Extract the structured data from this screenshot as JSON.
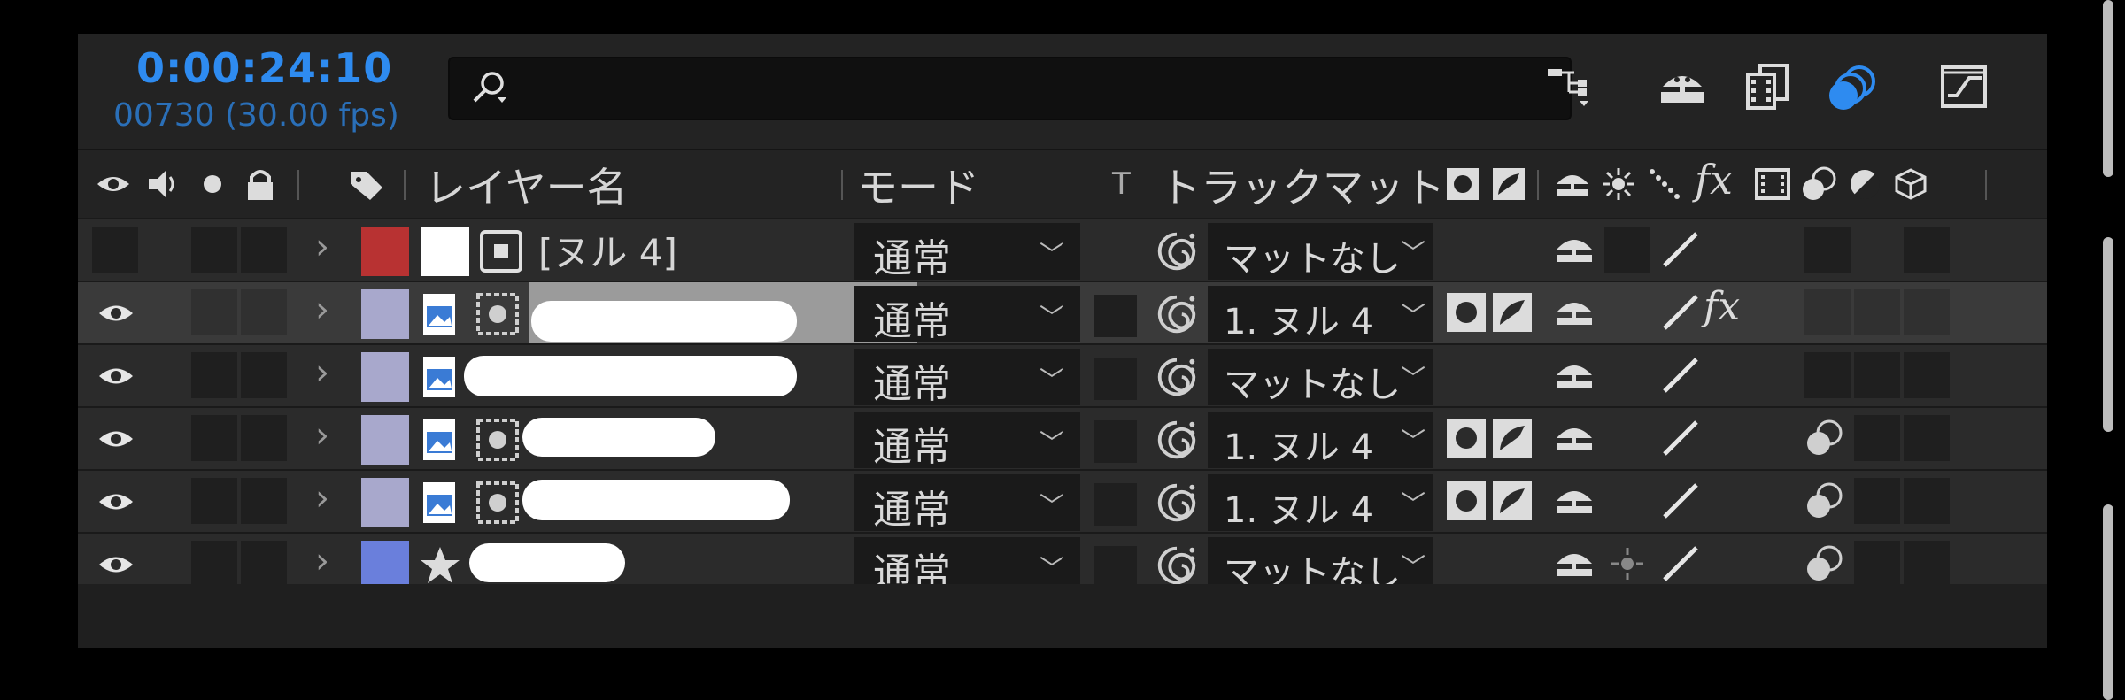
{
  "timeline": {
    "timecode": "0:00:24:10",
    "frames": "00730 (30.00 fps)",
    "search_placeholder": ""
  },
  "columns": {
    "layer_name": "レイヤー名",
    "mode": "モード",
    "t": "T",
    "track_matte": "トラックマット",
    "fx": "fx"
  },
  "layers": [
    {
      "name": "[ヌル 4]",
      "mode": "通常",
      "matte": "マットなし",
      "label_color": "#b83232",
      "visible": false,
      "selected": false
    },
    {
      "name": "",
      "mode": "通常",
      "matte": "1. ヌル 4",
      "label_color": "#a8a8cc",
      "visible": true,
      "selected": true,
      "fx": "fx"
    },
    {
      "name": "",
      "mode": "通常",
      "matte": "マットなし",
      "label_color": "#a8a8cc",
      "visible": true,
      "selected": false
    },
    {
      "name": "",
      "mode": "通常",
      "matte": "1. ヌル 4",
      "label_color": "#a8a8cc",
      "visible": true,
      "selected": false
    },
    {
      "name": "",
      "mode": "通常",
      "matte": "1. ヌル 4",
      "label_color": "#a8a8cc",
      "visible": true,
      "selected": false
    },
    {
      "name": "",
      "mode": "通常",
      "matte": "マットなし",
      "label_color": "#6a7fdc",
      "visible": true,
      "selected": false
    }
  ],
  "colors": {
    "accent": "#2e8bf0",
    "panel": "#1f1f1f"
  }
}
